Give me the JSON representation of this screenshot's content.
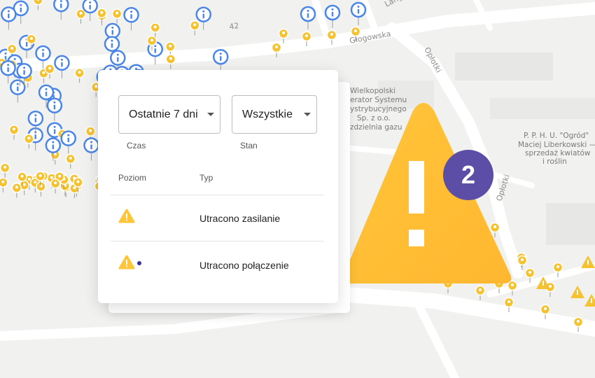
{
  "map": {
    "streets": {
      "glogowska": "Głogowska",
      "lange": "Lange",
      "oplotki_top": "Opłotki",
      "oplotki_mid": "Opłotki",
      "road_number": "42"
    },
    "poi": {
      "energy": [
        "Wielkopolski",
        "erator Systemu",
        "ystrybucyjnego",
        "Sp. z o.o.",
        "zdzielnia gazu"
      ],
      "garden": [
        "P. P. H. U. \"Ogród\"",
        "Maciej Liberkowski —",
        "sprzedaż kwiatów",
        "i roślin"
      ]
    },
    "colors": {
      "info_pin": "#4a86e8",
      "bulb_pin": "#f5c231",
      "alert": "#ffc53a"
    }
  },
  "filters": {
    "time": {
      "value": "Ostatnie 7 dni",
      "label": "Czas"
    },
    "state": {
      "value": "Wszystkie",
      "label": "Stan"
    }
  },
  "table": {
    "headers": {
      "level": "Poziom",
      "type": "Typ"
    },
    "rows": [
      {
        "type": "Utracono zasilanie",
        "level_icon": "warning-icon",
        "unread": false
      },
      {
        "type": "Utracono połączenie",
        "level_icon": "warning-icon",
        "unread": true
      }
    ]
  },
  "alert": {
    "count": "2",
    "icon": "warning-icon"
  },
  "colors": {
    "warning": "#ffc53a",
    "badge": "#5c4ea6",
    "unread_dot": "#3a2ea0"
  }
}
